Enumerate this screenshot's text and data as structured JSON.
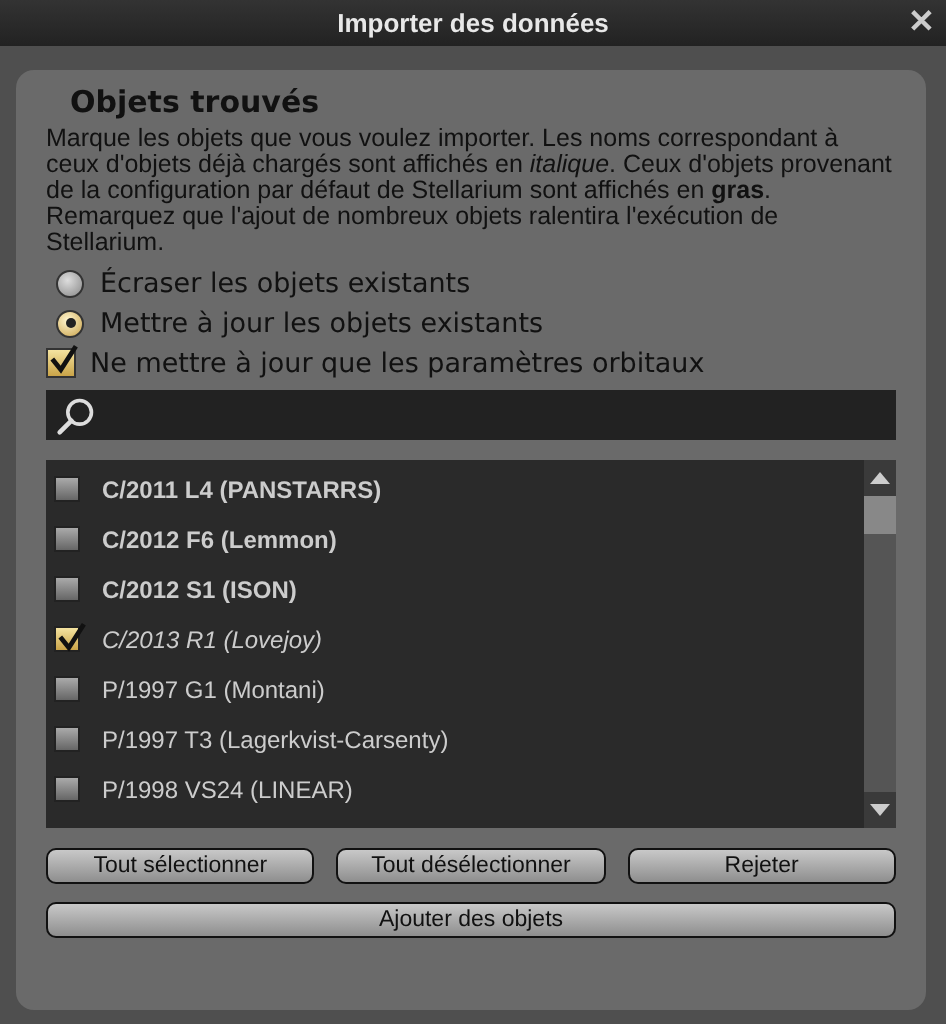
{
  "window": {
    "title": "Importer des données",
    "close": "✕"
  },
  "heading": "Objets trouvés",
  "description": [
    "Marque les objets que vous voulez importer. Les noms correspondant à ceux d'objets déjà chargés sont affichés en *italique*. Ceux d'objets provenant de la configuration par défaut de Stellarium sont affichés en **gras**.",
    "Remarquez que l'ajout de nombreux objets ralentira l'exécution de Stellarium."
  ],
  "options": [
    {
      "kind": "radio",
      "label": "Écraser les objets existants",
      "selected": false
    },
    {
      "kind": "radio",
      "label": "Mettre à jour les objets existants",
      "selected": true
    },
    {
      "kind": "checkbox",
      "label": "Ne mettre à jour que les paramètres orbitaux",
      "checked": true
    }
  ],
  "objects": [
    {
      "kind": "bold",
      "name": "C/2011 L4 (PANSTARRS)",
      "checked": false
    },
    {
      "kind": "bold",
      "name": "C/2012 F6 (Lemmon)",
      "checked": false
    },
    {
      "kind": "bold",
      "name": "C/2012 S1 (ISON)",
      "checked": false
    },
    {
      "kind": "italic",
      "name": "C/2013 R1 (Lovejoy)",
      "checked": true
    },
    {
      "kind": "plain",
      "name": "P/1997 G1 (Montani)",
      "checked": false
    },
    {
      "kind": "plain",
      "name": "P/1997 T3 (Lagerkvist-Carsenty)",
      "checked": false
    },
    {
      "kind": "plain",
      "name": "P/1998 VS24 (LINEAR)",
      "checked": false
    }
  ],
  "buttons": [
    "Tout sélectionner",
    "Tout désélectionner",
    "Rejeter"
  ],
  "add_button": "Ajouter des objets"
}
